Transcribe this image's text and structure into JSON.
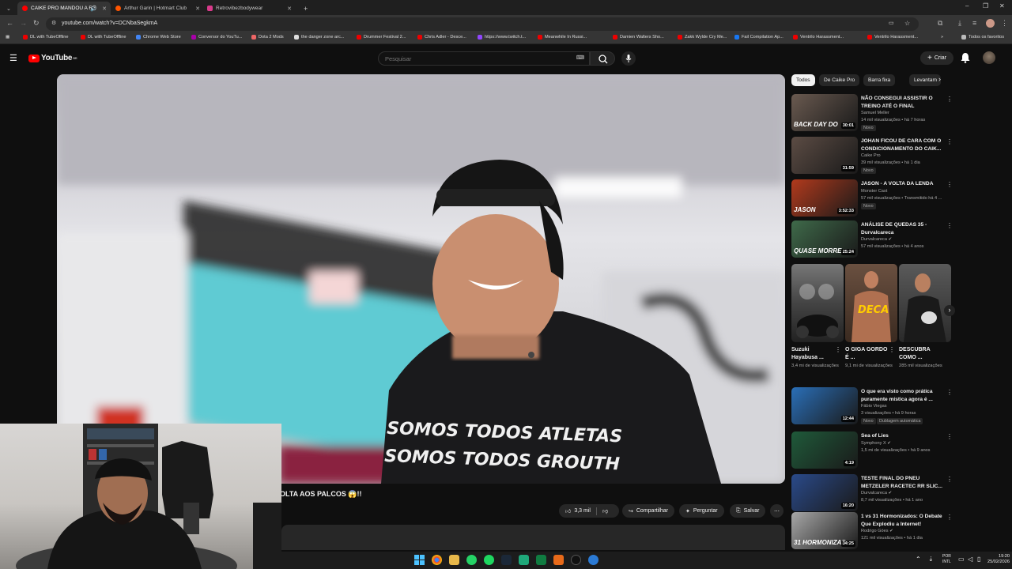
{
  "browser": {
    "tabs": [
      {
        "title": "CAIKE PRO MANDOU A RE",
        "active": true,
        "color": "#ff0000"
      },
      {
        "title": "Arthur Garin | Hotmart Club",
        "active": false,
        "color": "#ff5500"
      },
      {
        "title": "Retrovibezbodywear",
        "active": false,
        "color": "#d83a8a"
      }
    ],
    "new_tab": "+",
    "url": "youtube.com/watch?v=DCNbaSegkmA",
    "bookmarks": [
      {
        "label": "DL with TubeOffline",
        "color": "#e00"
      },
      {
        "label": "DL with TubeOffline",
        "color": "#e00"
      },
      {
        "label": "Chrome Web Store",
        "color": "#4285f4"
      },
      {
        "label": "Conversor do YouTu...",
        "color": "#a0a"
      },
      {
        "label": "Dota 2 Mods",
        "color": "#e66"
      },
      {
        "label": "the danger zone arc...",
        "color": "#ddd"
      },
      {
        "label": "Drummer Festival 2...",
        "color": "#e00"
      },
      {
        "label": "Chris Adler - Desce...",
        "color": "#e00"
      },
      {
        "label": "https://www.twitch.t...",
        "color": "#9146ff"
      },
      {
        "label": "Meanwhile In Russi...",
        "color": "#e00"
      },
      {
        "label": "Damien Walters Sho...",
        "color": "#e00"
      },
      {
        "label": "Zakk Wylde Cry Me...",
        "color": "#e00"
      },
      {
        "label": "Fail Compilation Ap...",
        "color": "#1877f2"
      },
      {
        "label": "Ventrilo Harassment...",
        "color": "#e00"
      },
      {
        "label": "Ventrilo Harassment...",
        "color": "#e00"
      }
    ],
    "all_favorites": "Todos os favoritos"
  },
  "youtube": {
    "logo_text": "YouTube",
    "logo_region": "BR",
    "search_placeholder": "Pesquisar",
    "create_label": "Criar",
    "video": {
      "title": "OLTA AOS PALCOS 😱!!",
      "shirt_line1": "SOMOS TODOS ATLETAS",
      "shirt_line2": "SOMOS TODOS GROUTH",
      "likes": "3,3 mil",
      "share": "Compartilhar",
      "ask": "Perguntar",
      "save": "Salvar"
    },
    "chips": [
      "Todos",
      "De Caike Pro",
      "Barra fixa",
      "Levantam"
    ],
    "recs": [
      {
        "title": "NÃO CONSEGUI ASSISTIR O TREINO ATÉ O FINAL",
        "channel": "Samuel Meller",
        "verified": false,
        "meta": "14 mil visualizações • há 7 horas",
        "badge": "Novo",
        "duration": "30:01",
        "thumb_text": "BACK DAY DO",
        "thumb": "#6a5a50"
      },
      {
        "title": "JOHAN FICOU DE CARA COM O CONDICIONAMENTO DO CAIK...",
        "channel": "Caike Pro",
        "verified": false,
        "meta": "39 mil visualizações • há 1 dia",
        "badge": "Novo",
        "duration": "31:59",
        "thumb_text": "",
        "thumb": "#5c4c44"
      },
      {
        "title": "JASON - A VOLTA DA LENDA",
        "channel": "Monster Cast",
        "verified": false,
        "meta": "57 mil visualizações • Transmitido há 4 ...",
        "badge": "Novo",
        "duration": "3:52:33",
        "thumb_text": "JASON",
        "thumb": "#b23a1c"
      },
      {
        "title": "ANÁLISE DE QUEDAS 35 - Durvalcareca",
        "channel": "Durvalcareca",
        "verified": true,
        "meta": "57 mil visualizações • há 4 anos",
        "badge": "",
        "duration": "25:24",
        "thumb_text": "QUASE MORRE",
        "thumb": "#3f6a4a"
      }
    ],
    "shorts": [
      {
        "title": "Suzuki Hayabusa ...",
        "views": "3,4 mi de visualizações",
        "thumb": "#555"
      },
      {
        "title": "O GIGA GORDO É ...",
        "views": "9,1 mi de visualizações",
        "thumb": "#7a5a3a",
        "thumb_text": "DECA"
      },
      {
        "title": "DESCUBRA COMO ...",
        "views": "285 mil visualizações",
        "thumb": "#4a4a4a"
      }
    ],
    "recs2": [
      {
        "title": "O que era visto como prática puramente mística agora é ...",
        "channel": "Fábio Viegas",
        "verified": false,
        "meta": "3 visualizações • há 9 horas",
        "badge": "Novo",
        "badge2": "Dublagem automática",
        "duration": "12:44",
        "thumb": "#2a6fb8"
      },
      {
        "title": "Sea of Lies",
        "channel": "Symphony X",
        "verified": true,
        "meta": "1,5 mi de visualizações • há 9 anos",
        "badge": "",
        "duration": "4:19",
        "thumb": "#1f5a3a"
      },
      {
        "title": "TESTE FINAL DO PNEU METZELER RACETEC RR SLIC...",
        "channel": "Durvalcareca",
        "verified": true,
        "meta": "8,7 mil visualizações • há 1 ano",
        "badge": "",
        "duration": "16:20",
        "thumb": "#2a4a8a"
      },
      {
        "title": "1 vs 31 Hormonizados: O Debate Que Explodiu a Internet!",
        "channel": "Rodrigo Góes",
        "verified": true,
        "meta": "121 mil visualizações • há 1 dia",
        "badge": "",
        "duration": "34:25",
        "thumb_text": "31 HORMONIZAD",
        "thumb": "#a8a8a8"
      }
    ]
  },
  "taskbar": {
    "lang1": "POR",
    "lang2": "INTL",
    "time": "19:20",
    "date": "25/02/2026"
  }
}
